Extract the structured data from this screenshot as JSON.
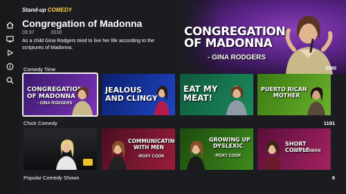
{
  "logo": {
    "part1": "Stand-up",
    "part2": "COMEDY"
  },
  "featured": {
    "title": "Congregation of Madonna",
    "duration": "03:37",
    "year": "2018",
    "description": "As a child Gina Rodgers tried to live her life according to the scriptures of Madonna.",
    "art_title_line1": "CONGREGATION",
    "art_title_line2": "OF MADONNA",
    "art_byline": "- GINA RODGERS",
    "count": "2990"
  },
  "sidebar": {
    "items": [
      {
        "name": "home",
        "icon": "home-icon"
      },
      {
        "name": "tv",
        "icon": "tv-icon"
      },
      {
        "name": "play",
        "icon": "play-icon"
      },
      {
        "name": "info",
        "icon": "info-icon"
      },
      {
        "name": "search",
        "icon": "search-icon"
      }
    ]
  },
  "rows": [
    {
      "label": "Comedy Time",
      "count": "",
      "tiles": [
        {
          "line1": "CONGREGATION",
          "line2": "OF MADONNA",
          "byline": "- GINA RODGERS"
        },
        {
          "line1": "JEALOUS",
          "line2": "AND CLINGY",
          "byline": ""
        },
        {
          "line1": "EAT MY",
          "line2": "MEAT!",
          "byline": ""
        },
        {
          "line1": "PUERTO RICAN",
          "line2": "MOTHER",
          "byline": ""
        }
      ]
    },
    {
      "label": "Chick Comedy",
      "count": "1191",
      "tiles": [
        {
          "line1": "",
          "line2": "",
          "byline": ""
        },
        {
          "line1": "COMMUNICATING",
          "line2": "WITH MEN",
          "byline": "-ROXY COOK"
        },
        {
          "line1": "GROWING UP",
          "line2": "DYSLEXIC",
          "byline": "-ROXY COOK"
        },
        {
          "line1": "SHORT COUPLE",
          "line2": "",
          "byline": "-JEN SEAMAN"
        }
      ]
    },
    {
      "label": "Popular Comedy Shows",
      "count": "6",
      "tiles": []
    }
  ],
  "colors": {
    "background": "#1b1c1f",
    "accent": "#ffd24a",
    "focus": "#f2f2f2"
  }
}
